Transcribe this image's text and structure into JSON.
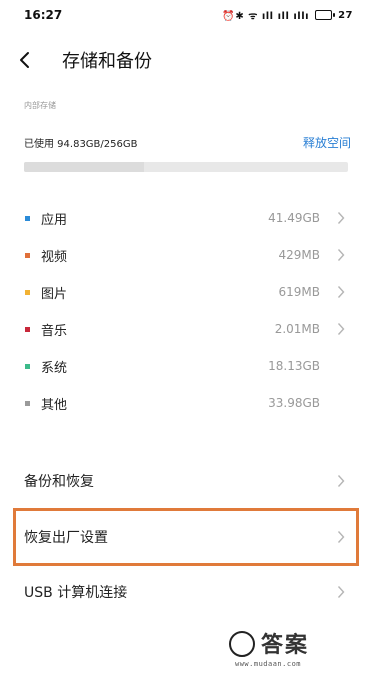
{
  "status_bar": {
    "time": "16:27",
    "icons": [
      "alarm-icon",
      "bluetooth-icon",
      "wifi-icon",
      "signal-icon",
      "signal-icon",
      "hd-signal-icon",
      "battery-icon"
    ],
    "icons_text": "⏰✱ ᯤ ıll ıll ıllı",
    "battery_level": "27"
  },
  "header": {
    "title": "存储和备份"
  },
  "storage": {
    "section_label": "内部存储",
    "usage_text": "已使用 94.83GB/256GB",
    "free_space_link": "释放空间",
    "used_fraction": 0.37
  },
  "categories": [
    {
      "label": "应用",
      "size": "41.49GB",
      "color": "#2b8bd8"
    },
    {
      "label": "视频",
      "size": "429MB",
      "color": "#e0703a"
    },
    {
      "label": "图片",
      "size": "619MB",
      "color": "#f2b233"
    },
    {
      "label": "音乐",
      "size": "2.01MB",
      "color": "#c8283a"
    },
    {
      "label": "系统",
      "size": "18.13GB",
      "color": "#3cba8a"
    },
    {
      "label": "其他",
      "size": "33.98GB",
      "color": "#9a9a9a"
    }
  ],
  "menu": {
    "backup": "备份和恢复",
    "factory_reset": "恢复出厂设置",
    "usb": "USB 计算机连接"
  },
  "watermark": {
    "text": "答案",
    "url": "www.mudaan.com"
  }
}
